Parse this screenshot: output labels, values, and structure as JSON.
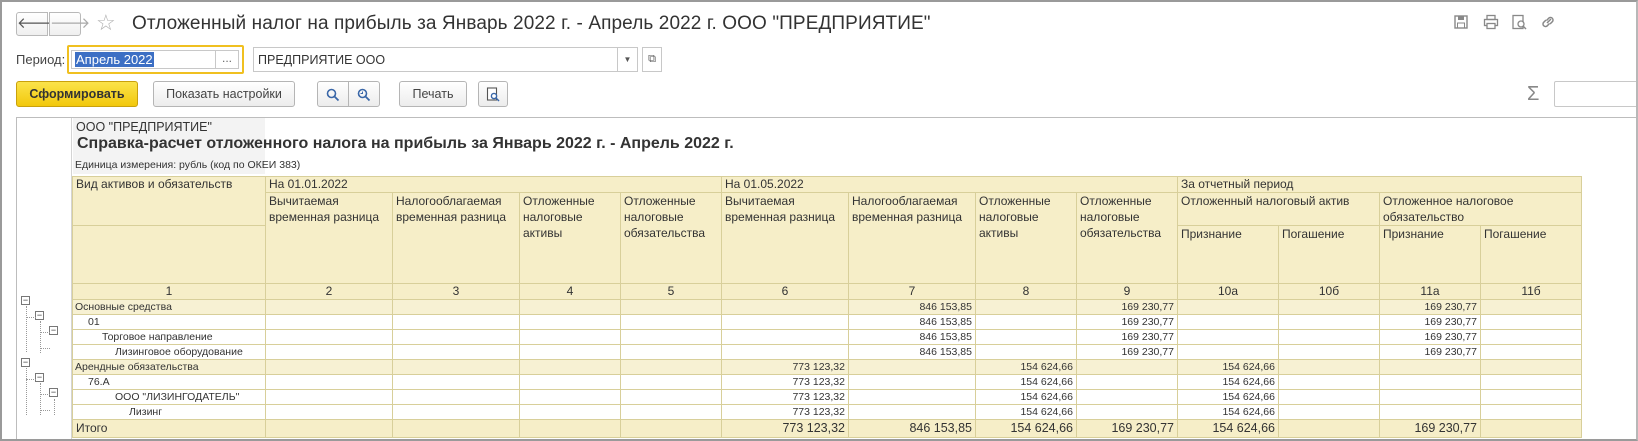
{
  "window": {
    "title": "Отложенный налог на прибыль за Январь 2022 г. - Апрель 2022 г. ООО \"ПРЕДПРИЯТИЕ\"",
    "back_glyph": "🡐",
    "forward_glyph": "🡒",
    "star_glyph": "☆",
    "icons": [
      "save-icon",
      "print-icon",
      "preview-icon",
      "link-icon"
    ]
  },
  "filters": {
    "period_label": "Период:",
    "period_value": "Апрель 2022",
    "period_dots": "...",
    "organization": "ПРЕДПРИЯТИЕ ООО"
  },
  "toolbar": {
    "generate": "Сформировать",
    "show_settings": "Показать настройки",
    "print": "Печать",
    "sigma": "Σ"
  },
  "report": {
    "org": "ООО \"ПРЕДПРИЯТИЕ\"",
    "title": "Справка-расчет отложенного налога на прибыль за Январь 2022 г. - Апрель 2022 г.",
    "unit": "Единица измерения: рубль (код по ОКЕИ 383)",
    "header": {
      "kind": "Вид активов и обязательств",
      "on_start": "На 01.01.2022",
      "on_end": "На 01.05.2022",
      "for_period": "За отчетный период",
      "deductible": "Вычитаемая временная разница",
      "taxable": "Налогооблагаемая временная разница",
      "dta": "Отложенные налоговые активы",
      "dtl": "Отложенные налоговые обязательства",
      "dta_single": "Отложенный налоговый актив",
      "dtl_single": "Отложенное налоговое обязательство",
      "recognition": "Признание",
      "repayment": "Погашение"
    },
    "column_numbers": [
      "1",
      "2",
      "3",
      "4",
      "5",
      "6",
      "7",
      "8",
      "9",
      "10а",
      "10б",
      "11а",
      "11б"
    ],
    "rows": [
      {
        "name": "Основные средства",
        "indent": 0,
        "group": true,
        "c6": "",
        "c7": "846 153,85",
        "c8": "",
        "c9": "169 230,77",
        "c10a": "",
        "c11a": "169 230,77"
      },
      {
        "name": "01",
        "indent": 1,
        "group": false,
        "c6": "",
        "c7": "846 153,85",
        "c8": "",
        "c9": "169 230,77",
        "c10a": "",
        "c11a": "169 230,77"
      },
      {
        "name": "Торговое направление",
        "indent": 2,
        "group": false,
        "c6": "",
        "c7": "846 153,85",
        "c8": "",
        "c9": "169 230,77",
        "c10a": "",
        "c11a": "169 230,77"
      },
      {
        "name": "Лизинговое оборудование",
        "indent": 3,
        "group": false,
        "c6": "",
        "c7": "846 153,85",
        "c8": "",
        "c9": "169 230,77",
        "c10a": "",
        "c11a": "169 230,77"
      },
      {
        "name": "Арендные обязательства",
        "indent": 0,
        "group": true,
        "c6": "773 123,32",
        "c7": "",
        "c8": "154 624,66",
        "c9": "",
        "c10a": "154 624,66",
        "c11a": ""
      },
      {
        "name": "76.А",
        "indent": 1,
        "group": false,
        "c6": "773 123,32",
        "c7": "",
        "c8": "154 624,66",
        "c9": "",
        "c10a": "154 624,66",
        "c11a": ""
      },
      {
        "name": "ООО \"ЛИЗИНГОДАТЕЛЬ\"",
        "indent": 3,
        "group": false,
        "c6": "773 123,32",
        "c7": "",
        "c8": "154 624,66",
        "c9": "",
        "c10a": "154 624,66",
        "c11a": ""
      },
      {
        "name": "Лизинг",
        "indent": 4,
        "group": false,
        "c6": "773 123,32",
        "c7": "",
        "c8": "154 624,66",
        "c9": "",
        "c10a": "154 624,66",
        "c11a": ""
      }
    ],
    "total": {
      "name": "Итого",
      "c6": "773 123,32",
      "c7": "846 153,85",
      "c8": "154 624,66",
      "c9": "169 230,77",
      "c10a": "154 624,66",
      "c11a": "169 230,77"
    }
  }
}
